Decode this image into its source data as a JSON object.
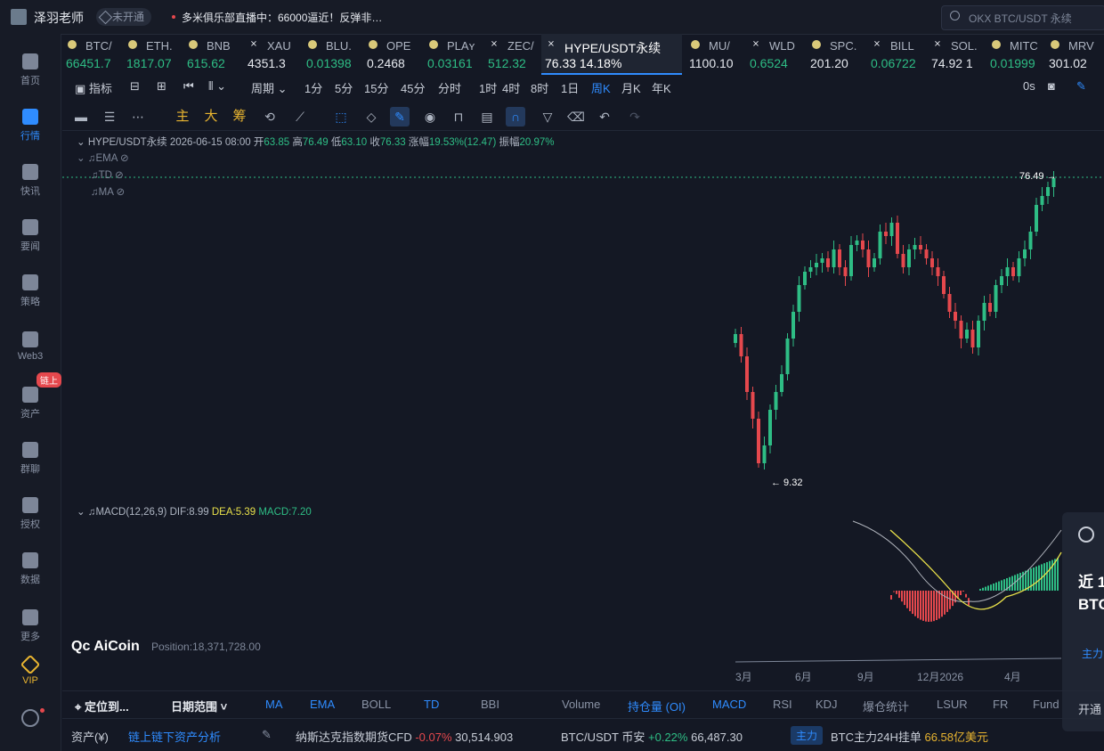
{
  "header": {
    "user_name": "泽羽老师",
    "vip_status": "未开通",
    "live_text": "多米俱乐部直播中：66000逼近！反弹非…",
    "search_placeholder": "OKX BTC/USDT 永续"
  },
  "nav": [
    {
      "label": "首页",
      "icon": "home-icon"
    },
    {
      "label": "行情",
      "icon": "chart-bar-icon",
      "active": true
    },
    {
      "label": "快讯",
      "icon": "news-icon"
    },
    {
      "label": "要闻",
      "icon": "document-icon"
    },
    {
      "label": "策略",
      "icon": "robot-icon"
    },
    {
      "label": "Web3",
      "icon": "web3-icon"
    },
    {
      "label": "资产",
      "icon": "wallet-icon"
    },
    {
      "label": "群聊",
      "icon": "chat-icon"
    },
    {
      "label": "授权",
      "icon": "key-icon"
    },
    {
      "label": "数据",
      "icon": "data-icon"
    },
    {
      "label": "更多",
      "icon": "grid-icon"
    },
    {
      "label": "VIP",
      "icon": "diamond-icon"
    }
  ],
  "nav_badge": "链上",
  "tickers": [
    {
      "symbol": "BTC/",
      "price": "66451.7"
    },
    {
      "symbol": "ETH.",
      "price": "1817.07"
    },
    {
      "symbol": "BNB",
      "price": "615.62"
    },
    {
      "symbol": "XAU",
      "price": "4351.3"
    },
    {
      "symbol": "BLU.",
      "price": "0.01398"
    },
    {
      "symbol": "OPE",
      "price": "0.2468"
    },
    {
      "symbol": "PLAʏ",
      "price": "0.03161"
    },
    {
      "symbol": "ZEC/",
      "price": "512.32"
    },
    {
      "symbol": "HYPE/USDT永续",
      "price": "76.33  14.18%",
      "active": true
    },
    {
      "symbol": "MU/",
      "price": "1100.10"
    },
    {
      "symbol": "WLD",
      "price": "0.6524"
    },
    {
      "symbol": "SPC.",
      "price": "201.20"
    },
    {
      "symbol": "BILL",
      "price": "0.06722"
    },
    {
      "symbol": "SOL.",
      "price": "74.92 1"
    },
    {
      "symbol": "MITC",
      "price": "0.01999"
    },
    {
      "symbol": "MRV",
      "price": "301.02"
    }
  ],
  "period_bar": {
    "indicator": "指标",
    "period": "周期",
    "intervals": [
      "1分",
      "5分",
      "15分",
      "45分",
      "分时",
      "1时",
      "4时",
      "8时",
      "1日",
      "周K",
      "月K",
      "年K"
    ],
    "active_interval": "周K",
    "countdown": "0s"
  },
  "draw_bar": {
    "main": "主",
    "big": "大",
    "chip": "筹"
  },
  "ohlc": {
    "symbol": "HYPE/USDT永续",
    "date": "2026-06-15 08:00",
    "open_label": "开",
    "open": "63.85",
    "high_label": "高",
    "high": "76.49",
    "low_label": "低",
    "low": "63.10",
    "close_label": "收",
    "close": "76.33",
    "change_label": "涨幅",
    "change": "19.53%(12.47)",
    "amp_label": "振幅",
    "amp": "20.97%"
  },
  "indicators": [
    "EMA",
    "TD",
    "MA"
  ],
  "macd": {
    "label": "MACD(12,26,9)",
    "dif": "DIF:8.99",
    "dea": "DEA:5.39",
    "macd": "MACD:7.20"
  },
  "logo": "AiCoin",
  "position": "Position:18,371,728.00",
  "chart_data": {
    "type": "candlestick",
    "high_marker": "76.49",
    "low_marker": "9.32",
    "x_tick_labels": [
      "3月",
      "6月",
      "9月",
      "12月2026",
      "4月"
    ],
    "colors": {
      "up": "#2ebd85",
      "down": "#e5484d",
      "dea": "#e8e04a",
      "dif": "#b0b4bc"
    }
  },
  "tab_bar": {
    "locate": "定位到...",
    "date_range": "日期范围",
    "main_tabs": [
      "MA",
      "EMA",
      "BOLL",
      "TD",
      "BBI"
    ],
    "sub_tabs": [
      "Volume",
      "持仓量 (OI)",
      "MACD",
      "RSI",
      "KDJ",
      "爆仓统计",
      "LSUR",
      "FR",
      "Fund"
    ]
  },
  "status_bar": {
    "asset": "资产(¥)",
    "asset_link": "链上链下资产分析",
    "index_name": "纳斯达克指数期货CFD",
    "index_change": "-0.07%",
    "index_value": "30,514.903",
    "pair": "BTC/USDT 币安",
    "pair_change": "+0.22%",
    "pair_value": "66,487.30",
    "badge": "主力",
    "mainforce_text": "BTC主力24H挂单",
    "mainforce_value": "66.58亿美元"
  },
  "popup": {
    "line1": "近 1",
    "line2": "BTC",
    "line3": "主力",
    "line4": "开通"
  }
}
